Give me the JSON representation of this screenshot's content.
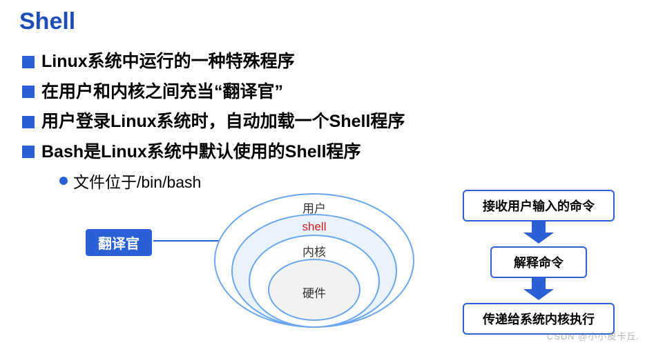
{
  "title": "Shell",
  "bullets": [
    "Linux系统中运行的一种特殊程序",
    "在用户和内核之间充当“翻译官”",
    "用户登录Linux系统时，自动加载一个Shell程序",
    "Bash是Linux系统中默认使用的Shell程序"
  ],
  "sub_bullet": "文件位于/bin/bash",
  "diagram": {
    "callout": "翻译官",
    "rings": {
      "outer": "用户",
      "shell": "shell",
      "kernel": "内核",
      "hardware": "硬件"
    },
    "flow": {
      "step1": "接收用户输入的命令",
      "step2": "解释命令",
      "step3": "传递给系统内核执行"
    }
  },
  "watermark": "CSDN @小小皮卡丘."
}
